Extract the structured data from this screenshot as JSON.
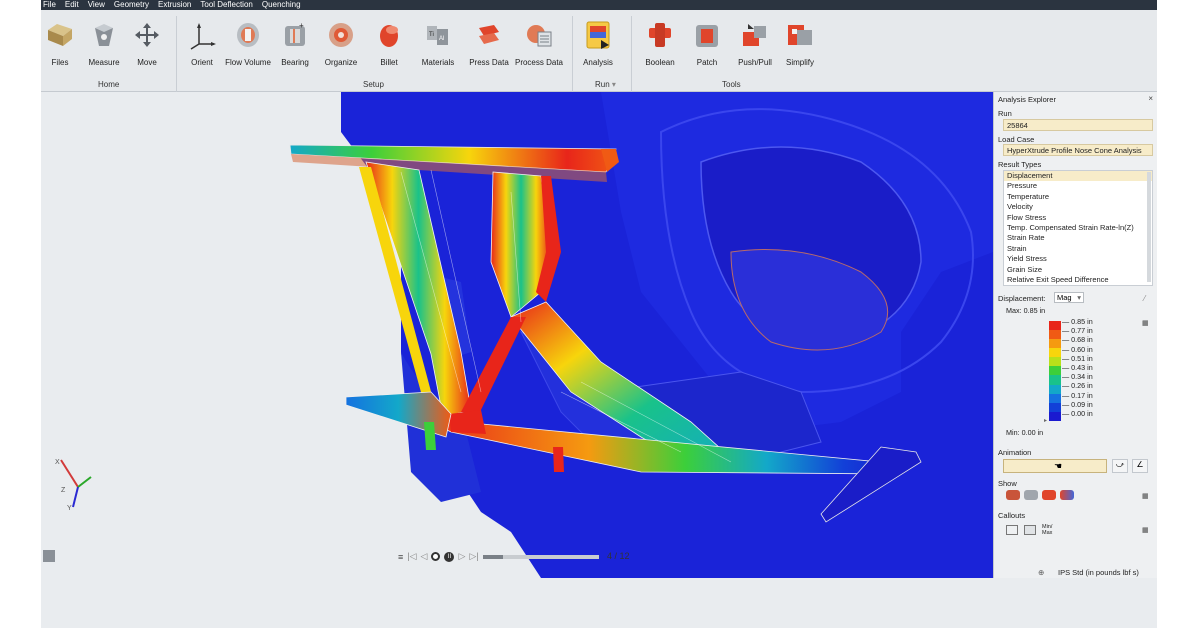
{
  "menu": [
    "File",
    "Edit",
    "View",
    "Geometry",
    "Extrusion",
    "Tool Deflection",
    "Quenching"
  ],
  "menu_active": "Extrusion",
  "ribbon": {
    "home": {
      "label": "Home",
      "tools": [
        "Files",
        "Measure",
        "Move"
      ]
    },
    "setup": {
      "label": "Setup",
      "tools": [
        "Orient",
        "Flow Volume",
        "Bearing",
        "Organize",
        "Billet",
        "Materials",
        "Press Data",
        "Process Data"
      ]
    },
    "run": {
      "label": "Run",
      "tools": [
        "Analysis"
      ]
    },
    "tools": {
      "label": "Tools",
      "tools": [
        "Boolean",
        "Patch",
        "Push/Pull",
        "Simplify"
      ]
    }
  },
  "explorer": {
    "title": "Analysis Explorer",
    "run_label": "Run",
    "run_value": "25864",
    "loadcase_label": "Load Case",
    "loadcase_value": "HyperXtrude Profile Nose Cone Analysis",
    "result_types_label": "Result Types",
    "result_types": [
      "Displacement",
      "Pressure",
      "Temperature",
      "Velocity",
      "Flow Stress",
      "Temp. Compensated Strain Rate-ln(Z)",
      "Strain Rate",
      "Strain",
      "Yield Stress",
      "Grain Size",
      "Relative Exit Speed Difference"
    ],
    "selected_result": "Displacement",
    "display_label": "Displacement:",
    "display_mode": "Mag",
    "max_label": "Max:",
    "max_value": "0.85 in",
    "min_label": "Min:",
    "min_value": "0.00 in",
    "legend_values": [
      "0.85 in",
      "0.77 in",
      "0.68 in",
      "0.60 in",
      "0.51 in",
      "0.43 in",
      "0.34 in",
      "0.26 in",
      "0.17 in",
      "0.09 in",
      "0.00 in"
    ],
    "legend_colors": [
      "#e8251a",
      "#f05a14",
      "#f59a10",
      "#f7d50c",
      "#b8e01a",
      "#3ccf3a",
      "#19c28a",
      "#13a8c9",
      "#1572e0",
      "#1240d8",
      "#1a1ad0"
    ],
    "animation_label": "Animation",
    "show_label": "Show",
    "callouts_label": "Callouts",
    "callout_minmax": "Min/ Max"
  },
  "playback": {
    "page": "4 / 12"
  },
  "units": "IPS Std (in pounds lbf s)",
  "triad": {
    "x": "X",
    "y": "Y",
    "z": "Z"
  }
}
